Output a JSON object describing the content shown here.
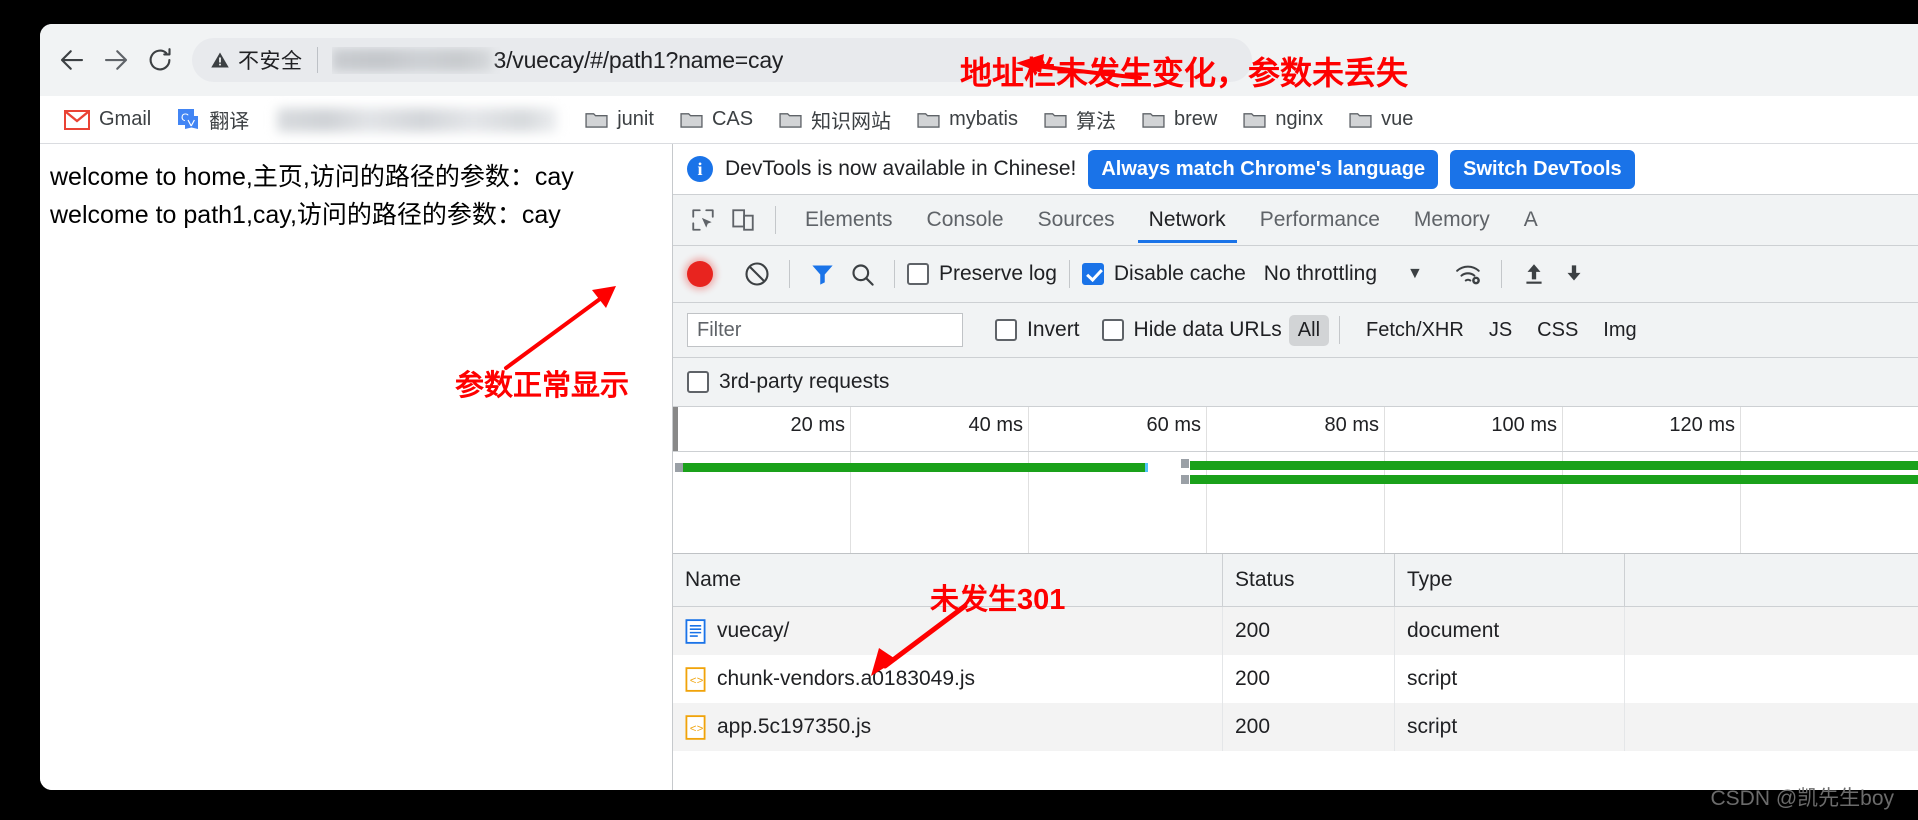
{
  "browser": {
    "nav": {
      "back_icon": "arrow-left-icon",
      "forward_icon": "arrow-right-icon",
      "reload_icon": "reload-icon"
    },
    "omnibox": {
      "security_icon": "warning-triangle-icon",
      "security_label": "不安全",
      "url_redacted": true,
      "url_visible": "3/vuecay/#/path1?name=cay"
    },
    "bookmarks": [
      {
        "label": "Gmail",
        "icon": "gmail-icon"
      },
      {
        "label": "翻译",
        "icon": "google-translate-icon"
      },
      {
        "label": "",
        "icon": "redacted-bookmarks"
      },
      {
        "label": "junit",
        "icon": "folder-icon"
      },
      {
        "label": "CAS",
        "icon": "folder-icon"
      },
      {
        "label": "知识网站",
        "icon": "folder-icon"
      },
      {
        "label": "mybatis",
        "icon": "folder-icon"
      },
      {
        "label": "算法",
        "icon": "folder-icon"
      },
      {
        "label": "brew",
        "icon": "folder-icon"
      },
      {
        "label": "nginx",
        "icon": "folder-icon"
      },
      {
        "label": "vue",
        "icon": "folder-icon"
      }
    ]
  },
  "page": {
    "lines": [
      "welcome to home,主页,访问的路径的参数：cay",
      "welcome to path1,cay,访问的路径的参数：cay"
    ]
  },
  "devtools": {
    "banner": {
      "info_icon": "info-circle-icon",
      "message": "DevTools is now available in Chinese!",
      "primary_button": "Always match Chrome's language",
      "secondary_button": "Switch DevTools"
    },
    "left_icons": [
      {
        "name": "inspect-element-icon"
      },
      {
        "name": "device-toolbar-icon"
      }
    ],
    "tabs": [
      {
        "label": "Elements",
        "active": false
      },
      {
        "label": "Console",
        "active": false
      },
      {
        "label": "Sources",
        "active": false
      },
      {
        "label": "Network",
        "active": true
      },
      {
        "label": "Performance",
        "active": false
      },
      {
        "label": "Memory",
        "active": false
      },
      {
        "label": "A",
        "active": false
      }
    ],
    "network_toolbar": {
      "record_icon": "record-button-icon",
      "clear_icon": "clear-prohibited-icon",
      "filter_icon": "funnel-filter-icon",
      "search_icon": "search-magnifier-icon",
      "preserve_log_label": "Preserve log",
      "preserve_log_checked": false,
      "disable_cache_label": "Disable cache",
      "disable_cache_checked": true,
      "throttling_value": "No throttling",
      "throttling_caret_icon": "chevron-down-icon",
      "network_conditions_icon": "wifi-settings-icon",
      "import_icon": "upload-arrow-icon",
      "export_icon": "download-arrow-icon"
    },
    "filter_bar": {
      "filter_placeholder": "Filter",
      "filter_value": "",
      "invert_label": "Invert",
      "invert_checked": false,
      "hide_data_urls_label": "Hide data URLs",
      "hide_data_urls_checked": false,
      "types": [
        "All",
        "Fetch/XHR",
        "JS",
        "CSS",
        "Img"
      ],
      "selected_type": "All",
      "third_party_label": "3rd-party requests",
      "third_party_checked": false
    },
    "timeline": {
      "ticks": [
        "20 ms",
        "40 ms",
        "60 ms",
        "80 ms",
        "100 ms",
        "120 ms"
      ],
      "bar_color": "#1aa11a"
    },
    "requests": {
      "columns": [
        "Name",
        "Status",
        "Type"
      ],
      "rows": [
        {
          "name": "vuecay/",
          "status": "200",
          "type": "document",
          "icon": "document-file-icon"
        },
        {
          "name": "chunk-vendors.a0183049.js",
          "status": "200",
          "type": "script",
          "icon": "script-file-icon"
        },
        {
          "name": "app.5c197350.js",
          "status": "200",
          "type": "script",
          "icon": "script-file-icon"
        }
      ]
    }
  },
  "annotations": {
    "color": "#fe0000",
    "url_note": "地址栏未发生变化，参数未丢失",
    "param_note": "参数正常显示",
    "no301_note": "未发生301"
  },
  "watermark": "CSDN @凯先生boy"
}
